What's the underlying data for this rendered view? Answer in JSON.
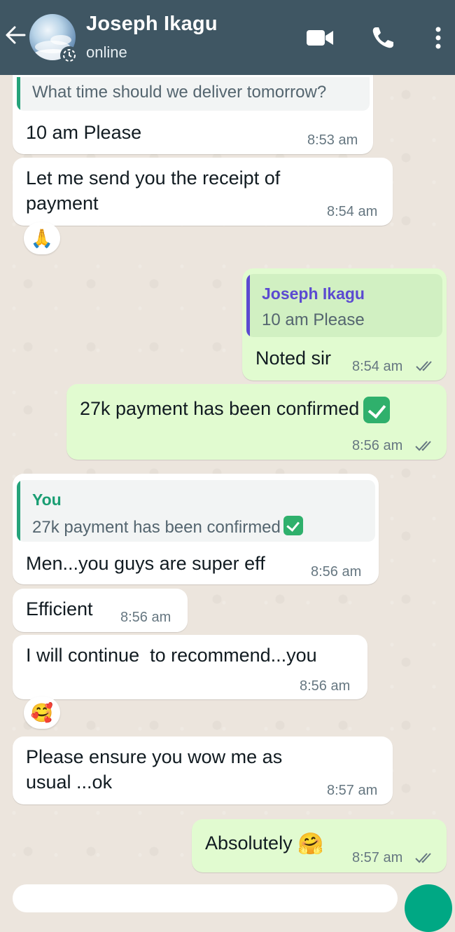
{
  "header": {
    "contact_name": "Joseph Ikagu",
    "status": "online",
    "icons": [
      "back-arrow-icon",
      "video-call-icon",
      "voice-call-icon",
      "more-options-icon"
    ]
  },
  "messages": [
    {
      "direction": "incoming",
      "quote_text": "What time should we deliver tomorrow?",
      "text": "10 am Please",
      "time": "8:53 am"
    },
    {
      "direction": "incoming",
      "text_line1": "Let me send you the receipt of",
      "text_line2": "payment",
      "time": "8:54 am",
      "reaction": "🙏"
    },
    {
      "direction": "outgoing",
      "quote_name": "Joseph Ikagu",
      "quote_text": "10 am Please",
      "text": "Noted sir",
      "time": "8:54 am"
    },
    {
      "direction": "outgoing",
      "text": "27k payment has been confirmed",
      "emoji": "check-mark-button",
      "time": "8:56 am"
    },
    {
      "direction": "incoming",
      "quote_name": "You",
      "quote_text": "27k payment has been confirmed",
      "text": "Men...you guys are super eff",
      "time": "8:56 am"
    },
    {
      "direction": "incoming",
      "text": "Efficient",
      "time": "8:56 am"
    },
    {
      "direction": "incoming",
      "text": "I will continue  to recommend...you",
      "time": "8:56 am",
      "reaction": "🥰"
    },
    {
      "direction": "incoming",
      "text_line1": "Please ensure you wow me as",
      "text_line2": "usual ...ok",
      "time": "8:57 am"
    },
    {
      "direction": "outgoing",
      "text": "Absolutely",
      "emoji": "🤗",
      "time": "8:57 am"
    }
  ],
  "colors": {
    "header_bg": "#3f5663",
    "chat_bg": "#ece5dd",
    "incoming_bubble": "#ffffff",
    "outgoing_bubble": "#e1fbd0",
    "read_ticks": "#667781",
    "quote_bar_green": "#25a37a",
    "quote_bar_purple": "#5b4ad1",
    "fab": "#00a884"
  }
}
